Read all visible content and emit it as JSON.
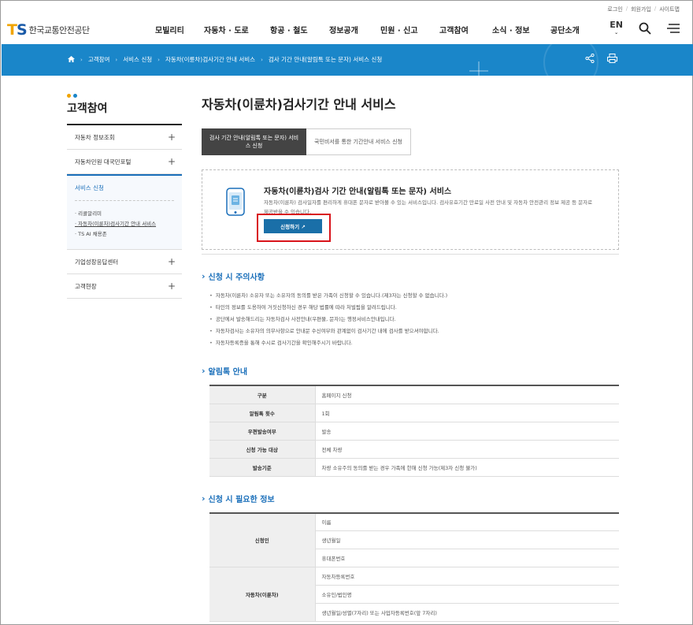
{
  "util_links": [
    "로그인",
    "회원가입",
    "사이트맵"
  ],
  "logo": {
    "ts": "TS",
    "name": "한국교통안전공단"
  },
  "gnb": [
    "모빌리티",
    "자동차 · 도로",
    "항공 · 철도",
    "정보공개",
    "민원 · 신고",
    "고객참여",
    "소식 · 정보",
    "공단소개"
  ],
  "lang": {
    "main": "EN"
  },
  "breadcrumb": [
    "고객참여",
    "서비스 신청",
    "자동차(이륜차)검사기간 안내 서비스",
    "검사 기간 안내(알림톡 또는 문자) 서비스 신청"
  ],
  "lnb": {
    "title": "고객참여",
    "items_top": [
      "자동차 정보조회",
      "자동차민원 대국민포털"
    ],
    "active": {
      "title": "서비스 신청",
      "subs": [
        "리콜알리미",
        "자동차(이륜차)검사기간 안내 서비스",
        "TS AI 채용존"
      ]
    },
    "items_bottom": [
      "기업성장응답센터",
      "고객현장"
    ]
  },
  "page_title": "자동차(이륜차)검사기간 안내 서비스",
  "tabs": [
    {
      "label": "검사 기간 안내(알림톡 또는 문자) 서비스 신청"
    },
    {
      "label": "국민비서를 통한 기간안내 서비스 신청"
    }
  ],
  "service": {
    "title": "자동차(이륜차)검사 기간 안내(알림톡 또는 문자) 서비스",
    "desc": "자동차(이륜차) 검사일자를 편리하게 휴대폰 문자로 받아볼 수 있는 서비스입니다. 검사유효기간 만료일 사전 안내 및 자동차 안전관리 정보 제공 등 문자로 제공받을 수 있습니다.",
    "button": "신청하기 ↗"
  },
  "notice": {
    "title": "신청 시 주의사항",
    "items": [
      "자동차(이륜차) 소유자 또는 소유자의 동의를 받은 가족이 신청할 수 있습니다.(제3자는 신청할 수 없습니다.)",
      "타인의 정보를 도용하여 거짓신청하신 경우 해당 법률에 따라 처벌됨을 알려드립니다.",
      "공단에서 발송해드리는 자동차검사 사전안내(우편물, 문자)는 행정서비스안내입니다.",
      "자동차검사는 소유자의 의무사항으로 안내문 수신여부와 관계없이 검사기간 내에 검사를 받으셔야합니다.",
      "자동차등록증을 통해 수시로 검사기간을 확인해주시기 바랍니다."
    ]
  },
  "alimtalk": {
    "title": "알림톡 안내",
    "rows": [
      {
        "k": "구분",
        "v": "홈페이지 신청"
      },
      {
        "k": "알림톡 횟수",
        "v": "1회"
      },
      {
        "k": "우편발송여부",
        "v": "발송"
      },
      {
        "k": "신청 가능 대상",
        "v": "전체 차량"
      },
      {
        "k": "발송기준",
        "v": "차량 소유주의 동의를 받는 경우 가족에 한해 신청 가능(제3자 신청 불가)"
      }
    ]
  },
  "required": {
    "title": "신청 시 필요한 정보",
    "groups": [
      {
        "k": "신청인",
        "vals": [
          "이름",
          "생년월일",
          "휴대폰번호"
        ]
      },
      {
        "k": "자동차(이륜차)",
        "vals": [
          "자동차등록번호",
          "소유인/법인명",
          "생년월일/성별(7자리) 또는 사업자등록번호(앞 7자리)"
        ]
      }
    ]
  },
  "colors": {
    "brand_blue": "#1a86c9",
    "accent": "#1a6fba",
    "highlight_red": "#d9141b",
    "logo_orange": "#f0a400"
  }
}
